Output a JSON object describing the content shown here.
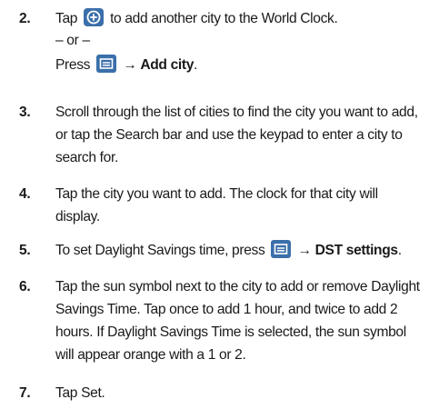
{
  "icons": {
    "add": "plus-in-circle-icon",
    "menu": "menu-key-icon",
    "accent": "#3a6faa"
  },
  "steps": [
    {
      "num": "2.",
      "pre": "Tap",
      "post": "to add another city to the World Clock.",
      "or": "– or –",
      "press": "Press",
      "arrow": "→",
      "action": "Add city",
      "end": "."
    },
    {
      "num": "3.",
      "text": "Scroll through the list of cities to find the city you want to add, or tap the Search bar and use the keypad to enter a city to search for."
    },
    {
      "num": "4.",
      "text": "Tap the city you want to add. The clock for that city will display."
    },
    {
      "num": "5.",
      "pre": "To set Daylight Savings time, press",
      "arrow": "→",
      "action": "DST settings",
      "end": "."
    },
    {
      "num": "6.",
      "text": "Tap the sun symbol next to the city to add or remove Daylight Savings Time. Tap once to add 1 hour, and twice to add 2 hours. If Daylight Savings Time is selected, the sun symbol will appear orange with a 1 or 2."
    },
    {
      "num": "7.",
      "text": "Tap Set."
    }
  ]
}
